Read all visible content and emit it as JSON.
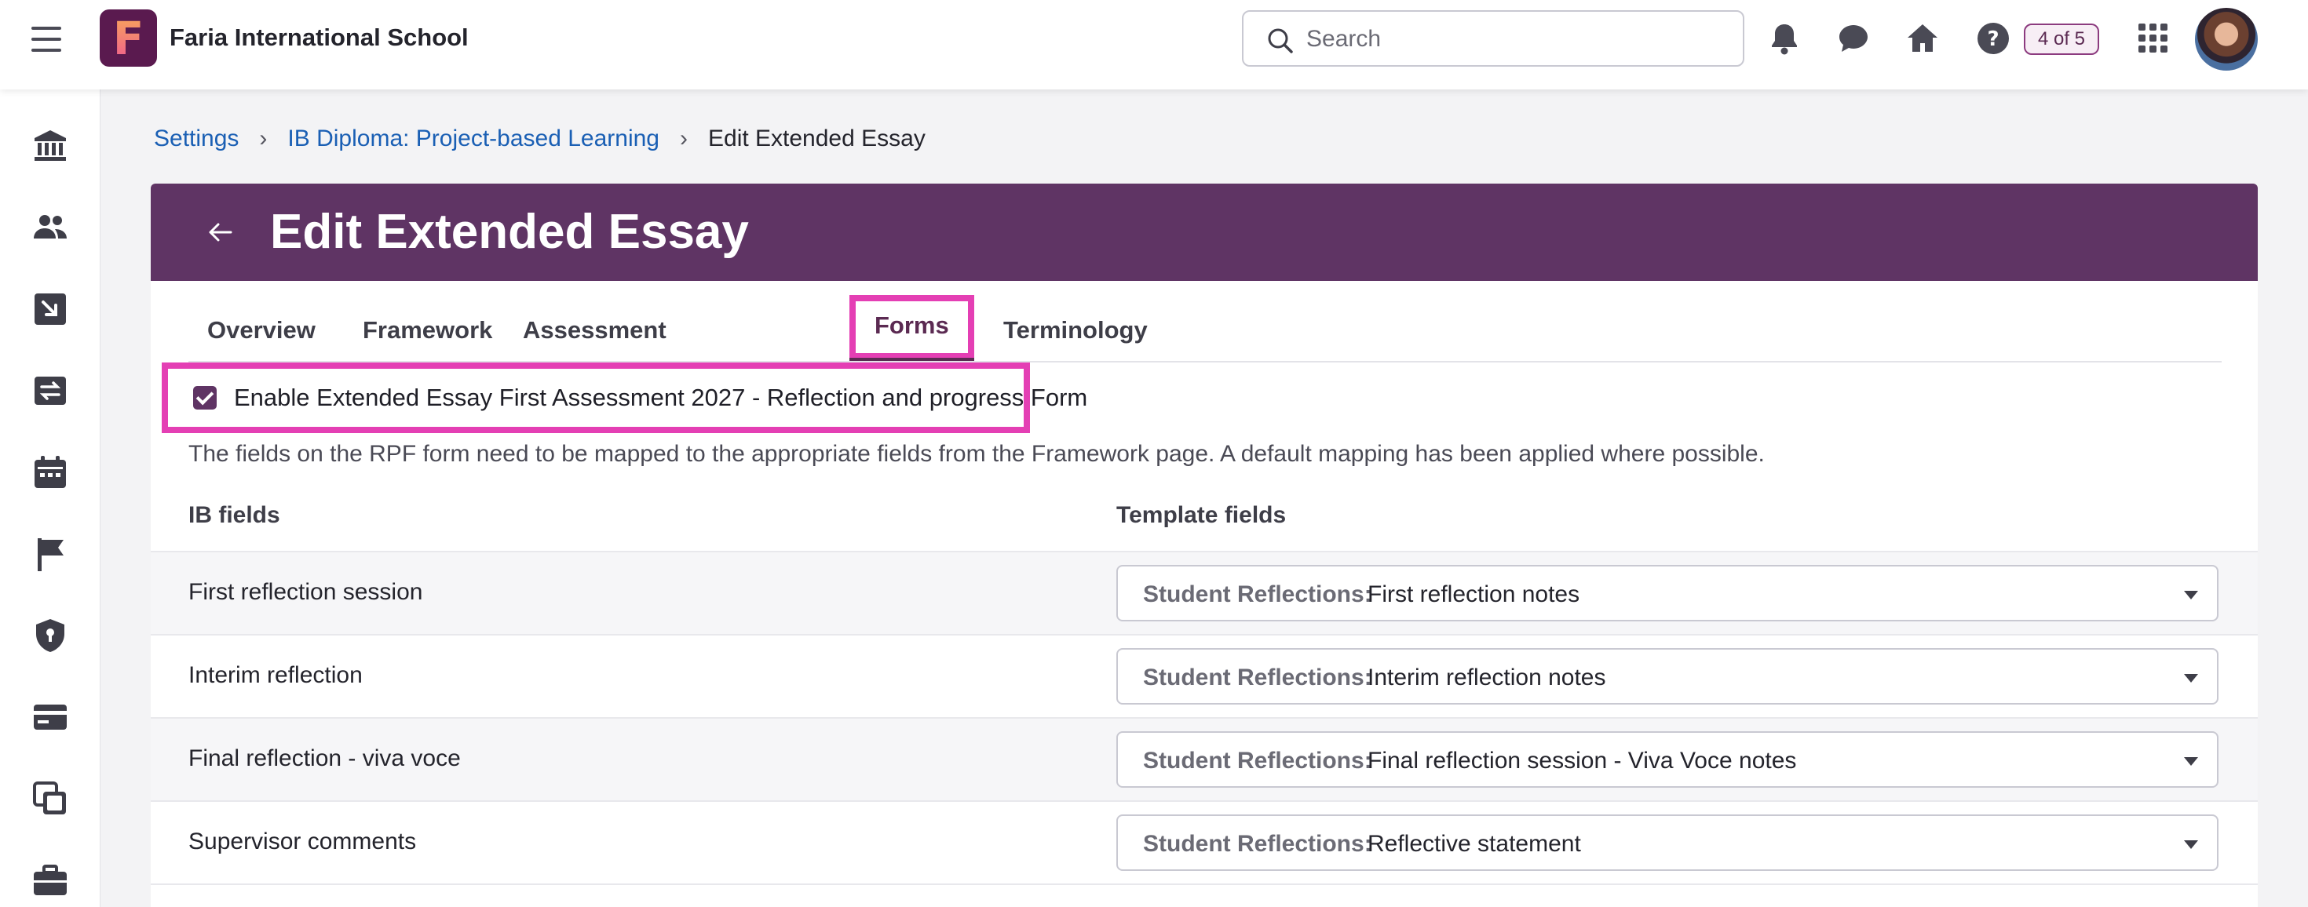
{
  "header": {
    "logo_letter": "F",
    "school_name": "Faria International School",
    "search_placeholder": "Search",
    "progress_pill": "4 of 5",
    "icons": [
      "menu-icon",
      "bell-icon",
      "chat-icon",
      "home-icon",
      "help-icon",
      "apps-grid-icon",
      "avatar"
    ]
  },
  "sidebar": {
    "icons": [
      "institution-icon",
      "people-icon",
      "download-icon",
      "sync-icon",
      "calendar-icon",
      "flag-icon",
      "shield-icon",
      "card-icon",
      "copy-icon",
      "briefcase-icon"
    ]
  },
  "breadcrumb": {
    "items": [
      "Settings",
      "IB Diploma: Project-based Learning"
    ],
    "current": "Edit Extended Essay"
  },
  "page": {
    "title": "Edit Extended Essay"
  },
  "tabs": [
    "Overview",
    "Framework",
    "Assessment",
    "Forms",
    "Terminology"
  ],
  "active_tab": "Forms",
  "forms": {
    "enable_label": "Enable Extended Essay First Assessment 2027 - Reflection and progress Form",
    "enabled": true,
    "description": "The fields on the RPF form need to be mapped to the appropriate fields from the Framework page. A default mapping has been applied where possible.",
    "columns": {
      "ib": "IB fields",
      "template": "Template fields"
    },
    "rows": [
      {
        "ib_field": "First reflection session",
        "prefix": "Student Reflections:",
        "value": "First reflection notes"
      },
      {
        "ib_field": "Interim reflection",
        "prefix": "Student Reflections:",
        "value": "Interim reflection notes"
      },
      {
        "ib_field": "Final reflection - viva voce",
        "prefix": "Student Reflections:",
        "value": "Final reflection session - Viva Voce notes"
      },
      {
        "ib_field": "Supervisor comments",
        "prefix": "Student Reflections:",
        "value": "Reflective statement"
      }
    ]
  },
  "colors": {
    "brand_purple": "#5f3464",
    "highlight_pink": "#e43fb4",
    "link_blue": "#1a5fb4"
  }
}
